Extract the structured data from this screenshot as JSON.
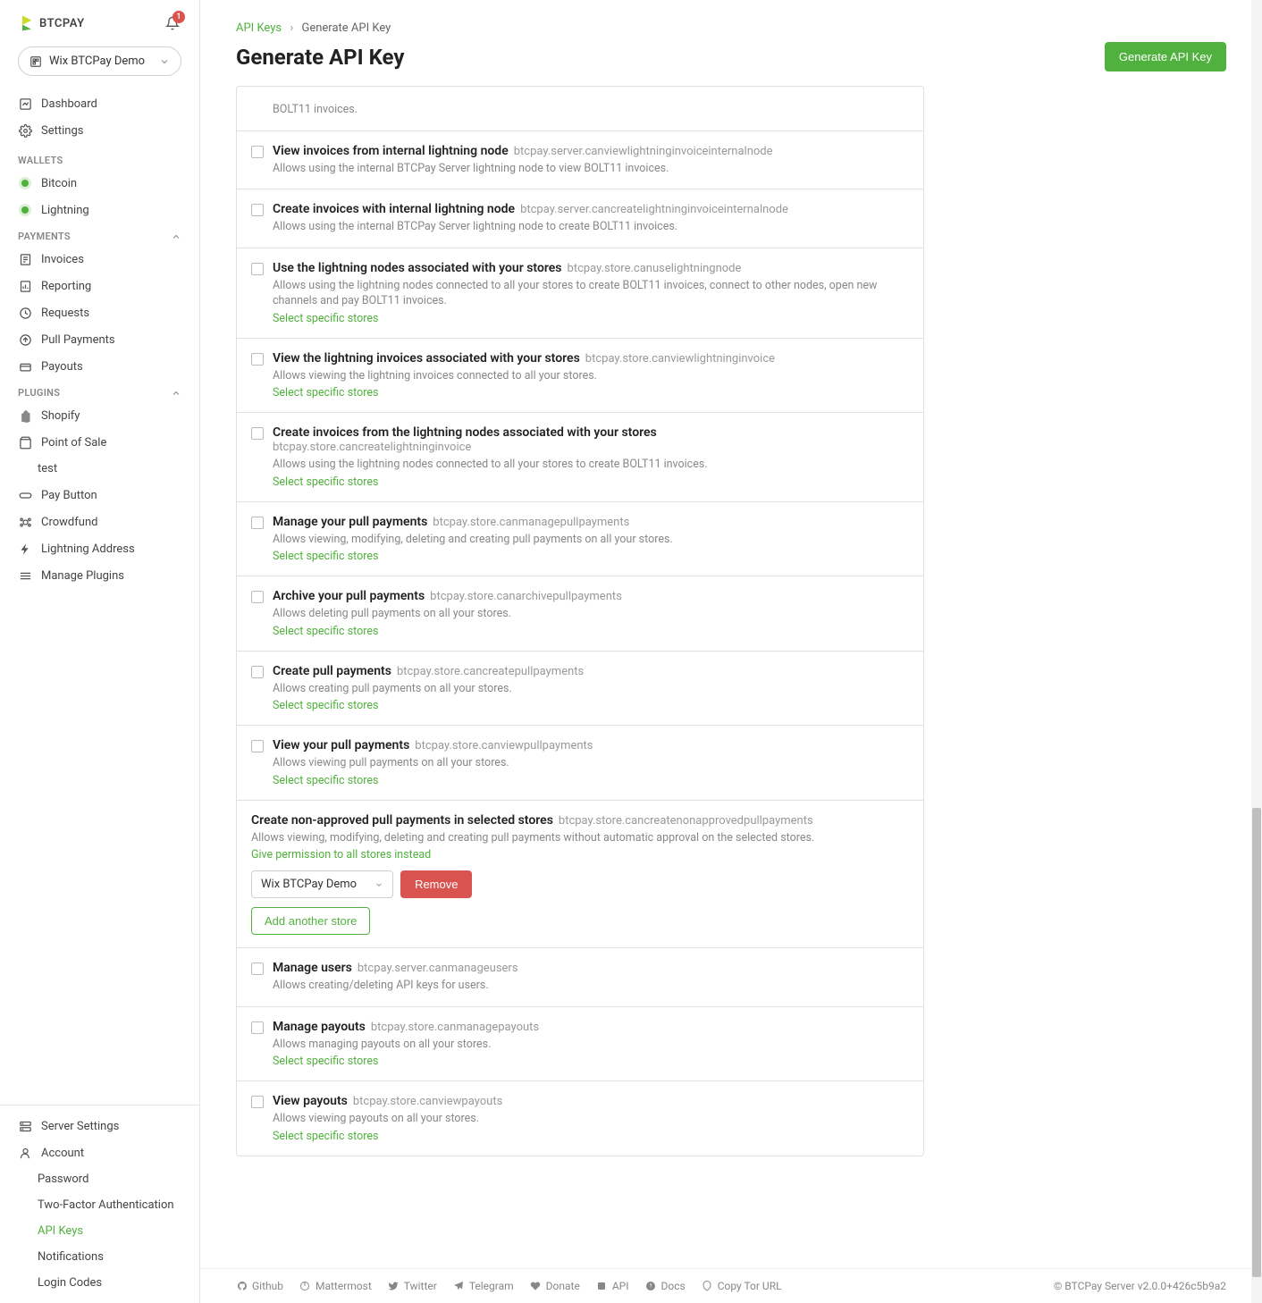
{
  "logo_text": "BTCPAY",
  "notification_count": "1",
  "store_selector": "Wix BTCPay Demo",
  "nav": {
    "dashboard": "Dashboard",
    "settings": "Settings",
    "wallets_label": "WALLETS",
    "bitcoin": "Bitcoin",
    "lightning": "Lightning",
    "payments_label": "PAYMENTS",
    "invoices": "Invoices",
    "reporting": "Reporting",
    "requests": "Requests",
    "pull_payments": "Pull Payments",
    "payouts": "Payouts",
    "plugins_label": "PLUGINS",
    "shopify": "Shopify",
    "pos": "Point of Sale",
    "pos_test": "test",
    "pay_button": "Pay Button",
    "crowdfund": "Crowdfund",
    "lightning_address": "Lightning Address",
    "manage_plugins": "Manage Plugins",
    "server_settings": "Server Settings",
    "account": "Account",
    "password": "Password",
    "two_factor": "Two-Factor Authentication",
    "api_keys": "API Keys",
    "notifications": "Notifications",
    "login_codes": "Login Codes"
  },
  "breadcrumb": {
    "parent": "API Keys",
    "current": "Generate API Key"
  },
  "page_title": "Generate API Key",
  "generate_btn": "Generate API Key",
  "select_stores": "Select specific stores",
  "give_all": "Give permission to all stores instead",
  "remove_btn": "Remove",
  "add_store_btn": "Add another store",
  "store_dd": "Wix BTCPay Demo",
  "perms": [
    {
      "title": "",
      "code": "",
      "desc": "BOLT11 invoices.",
      "link": false,
      "partial": true
    },
    {
      "title": "View invoices from internal lightning node",
      "code": "btcpay.server.canviewlightninginvoiceinternalnode",
      "desc": "Allows using the internal BTCPay Server lightning node to view BOLT11 invoices.",
      "link": false
    },
    {
      "title": "Create invoices with internal lightning node",
      "code": "btcpay.server.cancreatelightninginvoiceinternalnode",
      "desc": "Allows using the internal BTCPay Server lightning node to create BOLT11 invoices.",
      "link": false
    },
    {
      "title": "Use the lightning nodes associated with your stores",
      "code": "btcpay.store.canuselightningnode",
      "desc": "Allows using the lightning nodes connected to all your stores to create BOLT11 invoices, connect to other nodes, open new channels and pay BOLT11 invoices.",
      "link": true
    },
    {
      "title": "View the lightning invoices associated with your stores",
      "code": "btcpay.store.canviewlightninginvoice",
      "desc": "Allows viewing the lightning invoices connected to all your stores.",
      "link": true
    },
    {
      "title": "Create invoices from the lightning nodes associated with your stores",
      "code": "btcpay.store.cancreatelightninginvoice",
      "desc": "Allows using the lightning nodes connected to all your stores to create BOLT11 invoices.",
      "link": true,
      "code_break": true
    },
    {
      "title": "Manage your pull payments",
      "code": "btcpay.store.canmanagepullpayments",
      "desc": "Allows viewing, modifying, deleting and creating pull payments on all your stores.",
      "link": true
    },
    {
      "title": "Archive your pull payments",
      "code": "btcpay.store.canarchivepullpayments",
      "desc": "Allows deleting pull payments on all your stores.",
      "link": true
    },
    {
      "title": "Create pull payments",
      "code": "btcpay.store.cancreatepullpayments",
      "desc": "Allows creating pull payments on all your stores.",
      "link": true
    },
    {
      "title": "View your pull payments",
      "code": "btcpay.store.canviewpullpayments",
      "desc": "Allows viewing pull payments on all your stores.",
      "link": true
    },
    {
      "title": "Create non-approved pull payments in selected stores",
      "code": "btcpay.store.cancreatenonapprovedpullpayments",
      "desc": "Allows viewing, modifying, deleting and creating pull payments without automatic approval on the selected stores.",
      "nocheck": true,
      "give_all": true,
      "store_select": true
    },
    {
      "title": "Manage users",
      "code": "btcpay.server.canmanageusers",
      "desc": "Allows creating/deleting API keys for users.",
      "link": false
    },
    {
      "title": "Manage payouts",
      "code": "btcpay.store.canmanagepayouts",
      "desc": "Allows managing payouts on all your stores.",
      "link": true
    },
    {
      "title": "View payouts",
      "code": "btcpay.store.canviewpayouts",
      "desc": "Allows viewing payouts on all your stores.",
      "link": true
    }
  ],
  "footer": {
    "github": "Github",
    "mattermost": "Mattermost",
    "twitter": "Twitter",
    "telegram": "Telegram",
    "donate": "Donate",
    "api": "API",
    "docs": "Docs",
    "tor": "Copy Tor URL",
    "version": "© BTCPay Server v2.0.0+426c5b9a2"
  }
}
